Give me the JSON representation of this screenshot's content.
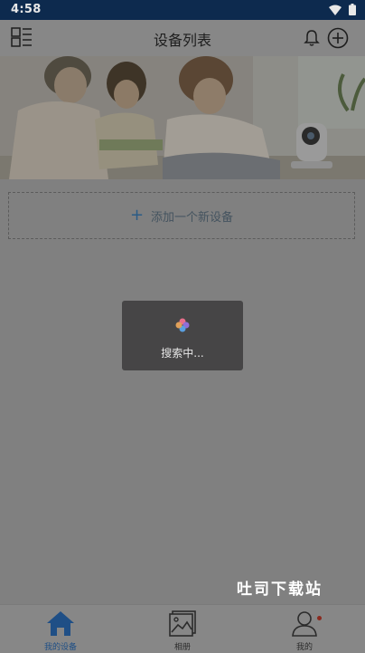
{
  "status": {
    "time": "4:58"
  },
  "header": {
    "title": "设备列表"
  },
  "add_device": {
    "label": "添加一个新设备"
  },
  "toast": {
    "text": "搜索中..."
  },
  "watermark": {
    "text": "吐司下载站"
  },
  "tabs": [
    {
      "label": "我的设备",
      "icon": "home-icon",
      "active": true
    },
    {
      "label": "相册",
      "icon": "album-icon",
      "active": false
    },
    {
      "label": "我的",
      "icon": "profile-icon",
      "active": false
    }
  ],
  "colors": {
    "active_tab": "#1f4f86",
    "status_bar": "#0d2a4e",
    "notification_dot": "#8a2a1f"
  }
}
